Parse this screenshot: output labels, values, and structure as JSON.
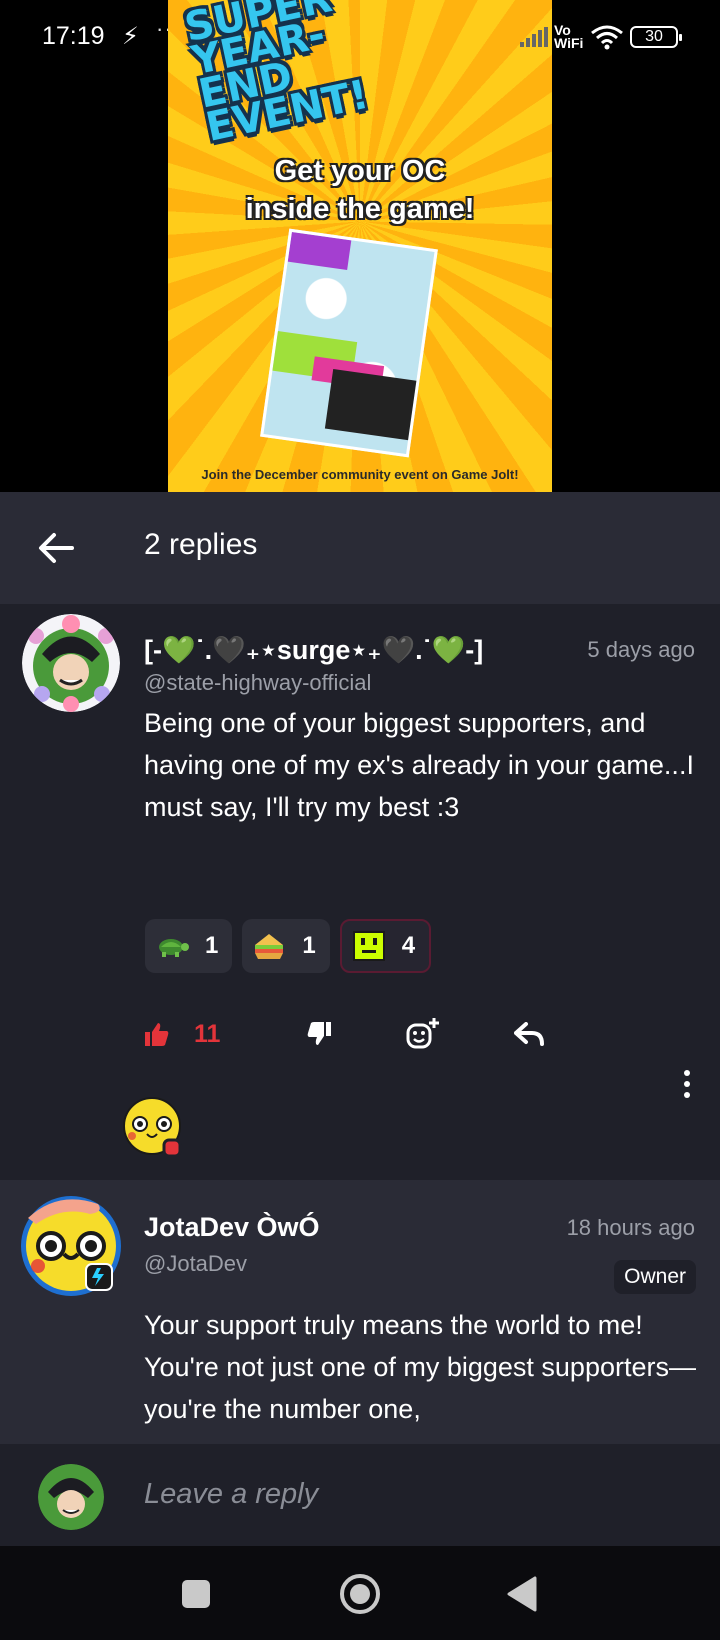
{
  "status_bar": {
    "time": "17:19",
    "flash_glyph": "⚡",
    "dots": "···",
    "vowifi": "Vo WiFi",
    "battery": "30"
  },
  "banner": {
    "title": "SUPER YEAR-END EVENT!",
    "subtitle_line1": "Get your OC",
    "subtitle_line2": "inside the game!",
    "footer": "Join the December community event on Game Jolt!"
  },
  "header": {
    "title": "2 replies"
  },
  "comment": {
    "name": "[-💚˙.🖤₊⋆surge⋆₊🖤.˙💚-]",
    "handle": "@state-highway-official",
    "time": "5 days ago",
    "text": "Being one of your biggest supporters, and having one of my ex's already in your game...I must say, I'll try my best :3",
    "reactions": [
      {
        "icon": "turtle-icon",
        "count": "1"
      },
      {
        "icon": "sandwich-icon",
        "count": "1"
      },
      {
        "icon": "pixel-face-icon",
        "count": "4"
      }
    ],
    "like_count": "11"
  },
  "reply": {
    "name": "JotaDev ÒwÓ",
    "handle": "@JotaDev",
    "time": "18 hours ago",
    "badge": "Owner",
    "text": "Your support truly means the world to me! You're not just one of my biggest supporters—you're the number one,"
  },
  "reply_bar": {
    "placeholder": "Leave a reply"
  },
  "colors": {
    "header_bg": "#2a2b36",
    "content_bg": "#1f2029",
    "like_red": "#e3343a",
    "muted_text": "#9c9fa8",
    "banner_yellow": "#ffc515",
    "title_blue": "#35c6ef"
  }
}
